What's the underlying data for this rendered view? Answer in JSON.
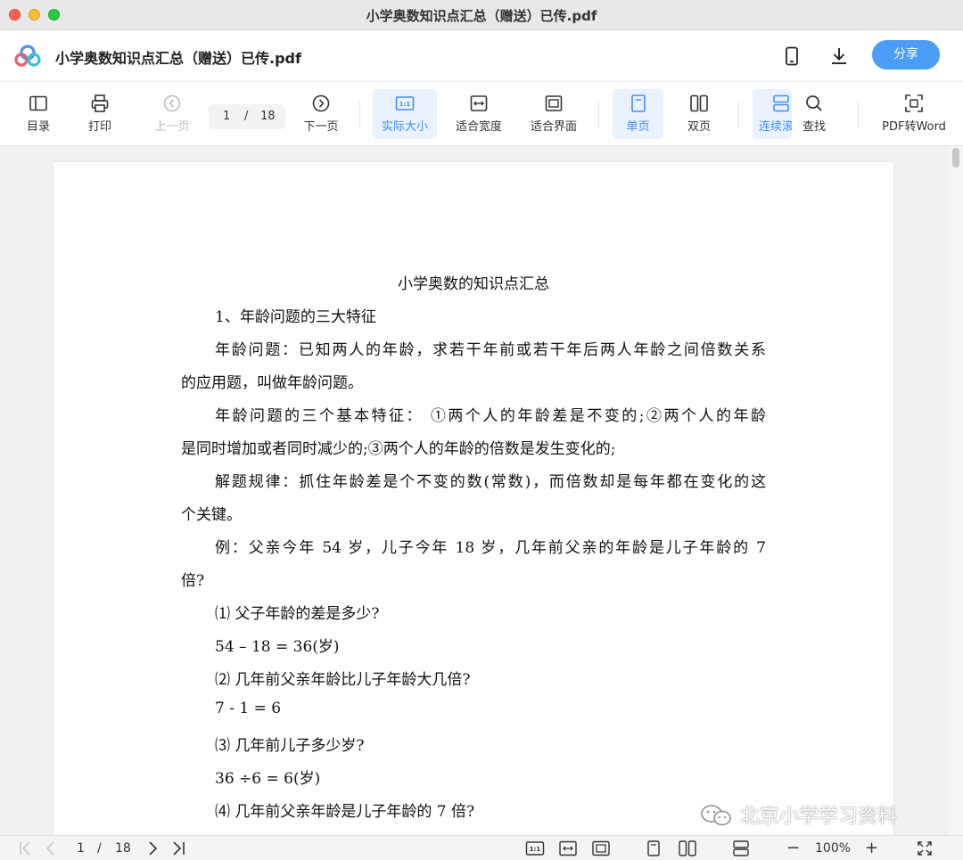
{
  "window": {
    "title": "小学奥数知识点汇总（赠送）已传.pdf"
  },
  "header": {
    "doc_name": "小学奥数知识点汇总（赠送）已传.pdf",
    "share_label": "分享",
    "icons": [
      "app-logo-icon",
      "phone-icon",
      "download-icon"
    ]
  },
  "toolbar": {
    "toc": "目录",
    "print": "打印",
    "prev": "上一页",
    "page_current": "1",
    "page_sep": "/",
    "page_total": "18",
    "next": "下一页",
    "actual_size": "实际大小",
    "fit_width": "适合宽度",
    "fit_screen": "适合界面",
    "single": "单页",
    "double": "双页",
    "continuous": "连续滚",
    "find": "查找",
    "pdf_to_word": "PDF转Word",
    "accent": "#3d8ff5"
  },
  "document": {
    "title": "小学奥数的知识点汇总",
    "lines": [
      "1、年龄问题的三大特征",
      "年龄问题：已知两人的年龄，求若干年前或若干年后两人年龄之间倍数关系",
      "的应用题，叫做年龄问题。",
      "年龄问题的三个基本特征：  ①两个人的年龄差是不变的;②两个人的年龄",
      "是同时增加或者同时减少的;③两个人的年龄的倍数是发生变化的;",
      "解题规律：抓住年龄差是个不变的数(常数)，而倍数却是每年都在变化的这",
      "个关键。",
      "例：父亲今年 54 岁，儿子今年 18 岁，几年前父亲的年龄是儿子年龄的 7",
      "倍?",
      "⑴ 父子年龄的差是多少?",
      "54 – 18 = 36(岁)",
      "⑵ 几年前父亲年龄比儿子年龄大几倍?",
      "7 - 1 = 6",
      "⑶ 几年前儿子多少岁?",
      "36 ÷6 = 6(岁)",
      "⑷ 几年前父亲年龄是儿子年龄的 7 倍?"
    ]
  },
  "watermark": "北京小学学习资料",
  "bottombar": {
    "page_current": "1",
    "page_sep": "/",
    "page_total": "18",
    "zoom": "100%",
    "minus": "−",
    "plus": "+"
  }
}
